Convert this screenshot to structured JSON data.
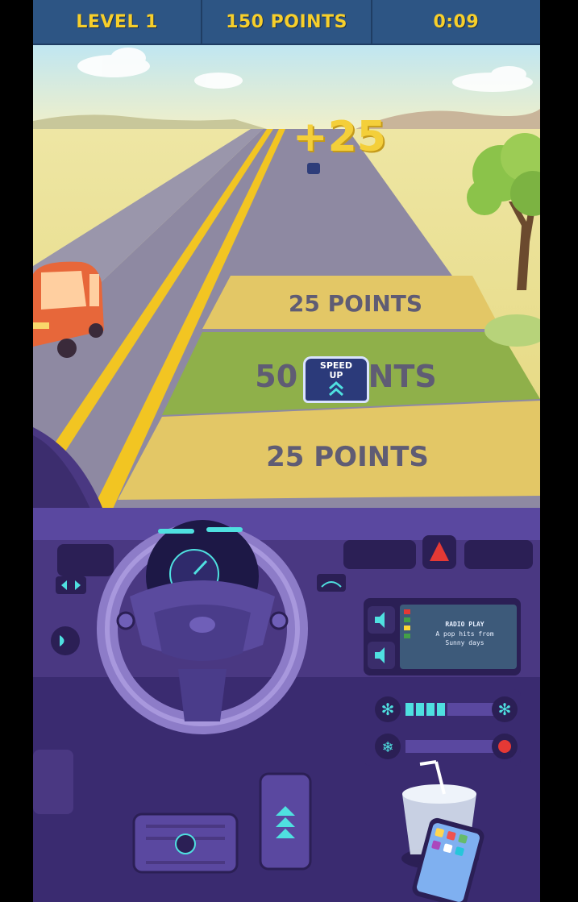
{
  "hud": {
    "level": "LEVEL 1",
    "points": "150 POINTS",
    "timer": "0:09"
  },
  "road": {
    "bonus_popup": "+25",
    "zone_top_label": "25 POINTS",
    "zone_middle_label": "50 POINTS",
    "zone_bottom_label": "25 POINTS"
  },
  "speed_up_button": {
    "line1": "SPEED",
    "line2": "UP"
  },
  "radio": {
    "title": "RADIO PLAY",
    "line2": "A pop hits from",
    "line3": "Sunny days"
  },
  "colors": {
    "hud_bg": "#2d5584",
    "hud_text": "#f7cf2b",
    "zone_yellow": "#e3c766",
    "zone_green": "#8fb04a",
    "dashboard": "#3a2d6b",
    "accent_cyan": "#4fe0e0"
  },
  "icons": {
    "hazard": "hazard-triangle-icon",
    "horn": "horn-icon",
    "parking": "parking-brake-icon",
    "fan": "snowflake-icon",
    "volume_up": "volume-up-icon",
    "volume_down": "volume-down-icon",
    "accelerator": "chevron-up-icon"
  }
}
